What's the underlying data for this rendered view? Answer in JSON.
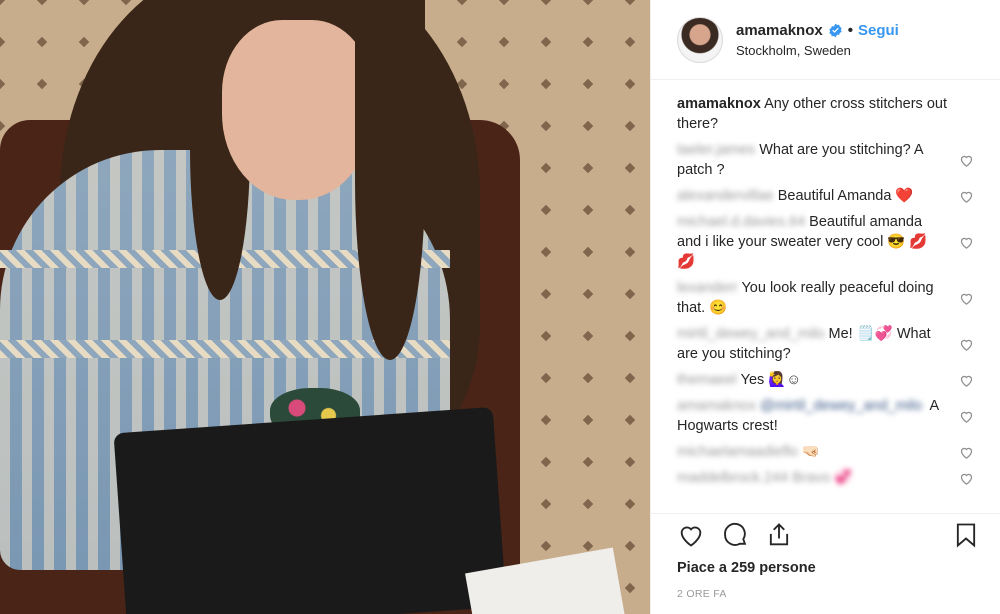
{
  "post": {
    "username": "amamaknox",
    "separator": "•",
    "follow_label": "Segui",
    "location": "Stockholm, Sweden",
    "caption": {
      "username": "amamaknox",
      "text": "Any other cross stitchers out there?"
    },
    "comments": [
      {
        "user": "taeler.james",
        "text": "What are you stitching? A patch ?"
      },
      {
        "user": "alexandervillae",
        "text": "Beautiful Amanda ❤️"
      },
      {
        "user": "michael.d.davies.64",
        "text": "Beautiful amanda and i like your sweater very cool 😎 💋 💋"
      },
      {
        "user": "lexanderr",
        "text": "You look really peaceful doing that. 😊"
      },
      {
        "user": "mirtil_dewey_and_milo",
        "text": "Me! 🗒️💞 What are you stitching?"
      },
      {
        "user": "themaeel",
        "text": "Yes 🙋‍♀️☺"
      },
      {
        "user": "amamaknox",
        "mention": "@mirtil_dewey_and_milo",
        "text": "A Hogwarts crest!"
      },
      {
        "user": "michaelamaadieflo",
        "text": "🤜🏻"
      },
      {
        "user": "maddelbrock.244",
        "text": "Bravo 💞"
      }
    ],
    "likes": "Piace a 259 persone",
    "timestamp": "2 ORE FA",
    "colors": {
      "link": "#3897f0",
      "text": "#262626",
      "muted": "#999999"
    },
    "icons": [
      "heart-icon",
      "comment-icon",
      "share-icon",
      "bookmark-icon",
      "verified-badge-icon"
    ]
  }
}
